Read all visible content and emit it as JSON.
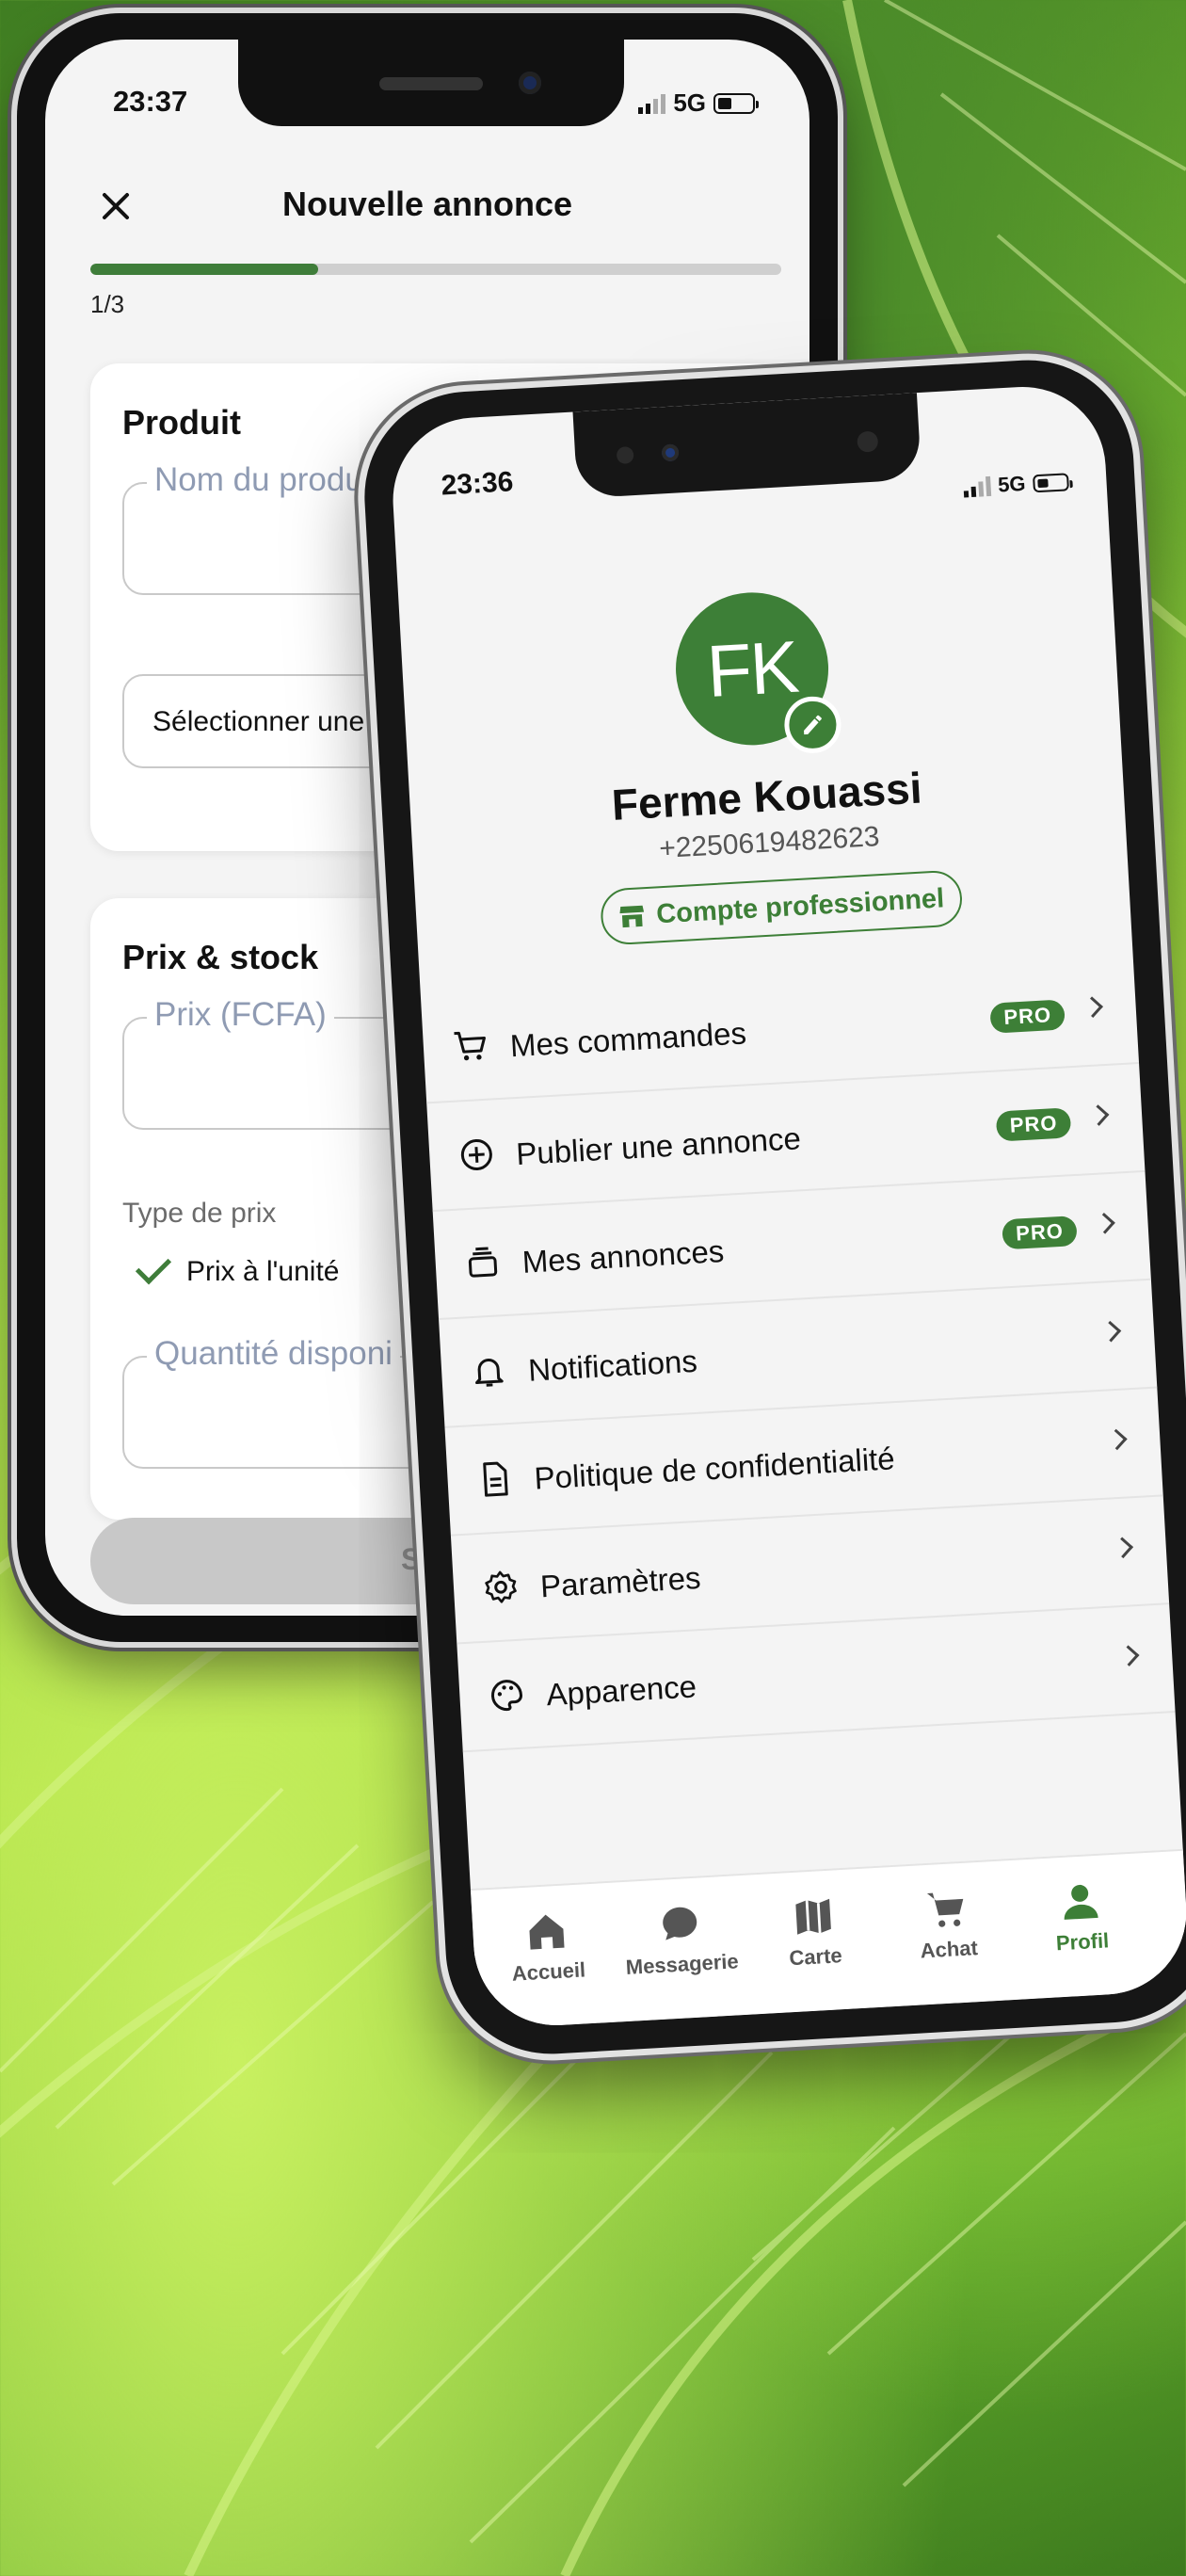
{
  "back_phone": {
    "time": "23:37",
    "network": "5G",
    "title": "Nouvelle annonce",
    "progress_fraction": 0.33,
    "step": "1/3",
    "product_card": {
      "heading": "Produit",
      "name_placeholder": "Nom du produit",
      "category_select": "Sélectionner une ca"
    },
    "price_card": {
      "heading": "Prix & stock",
      "price_placeholder": "Prix (FCFA)",
      "price_type_label": "Type de prix",
      "price_type_option": "Prix à l'unité",
      "quantity_placeholder": "Quantité disponi"
    },
    "submit_label": "Su"
  },
  "front_phone": {
    "time": "23:36",
    "network": "5G",
    "profile": {
      "initials": "FK",
      "name": "Ferme Kouassi",
      "phone": "+2250619482623",
      "account_type": "Compte professionnel"
    },
    "menu": [
      {
        "label": "Mes commandes",
        "icon": "cart-icon",
        "badge": "PRO"
      },
      {
        "label": "Publier une annonce",
        "icon": "plus-circle-icon",
        "badge": "PRO"
      },
      {
        "label": "Mes annonces",
        "icon": "stack-icon",
        "badge": "PRO"
      },
      {
        "label": "Notifications",
        "icon": "bell-icon",
        "badge": ""
      },
      {
        "label": "Politique de confidentialité",
        "icon": "document-icon",
        "badge": ""
      },
      {
        "label": "Paramètres",
        "icon": "gear-icon",
        "badge": ""
      },
      {
        "label": "Apparence",
        "icon": "palette-icon",
        "badge": ""
      }
    ],
    "tabs": [
      {
        "label": "Accueil",
        "icon": "home-icon"
      },
      {
        "label": "Messagerie",
        "icon": "chat-icon"
      },
      {
        "label": "Carte",
        "icon": "map-icon"
      },
      {
        "label": "Achat",
        "icon": "cart-icon"
      },
      {
        "label": "Profil",
        "icon": "person-icon",
        "active": true
      }
    ],
    "accent_color": "#3d7f37"
  }
}
